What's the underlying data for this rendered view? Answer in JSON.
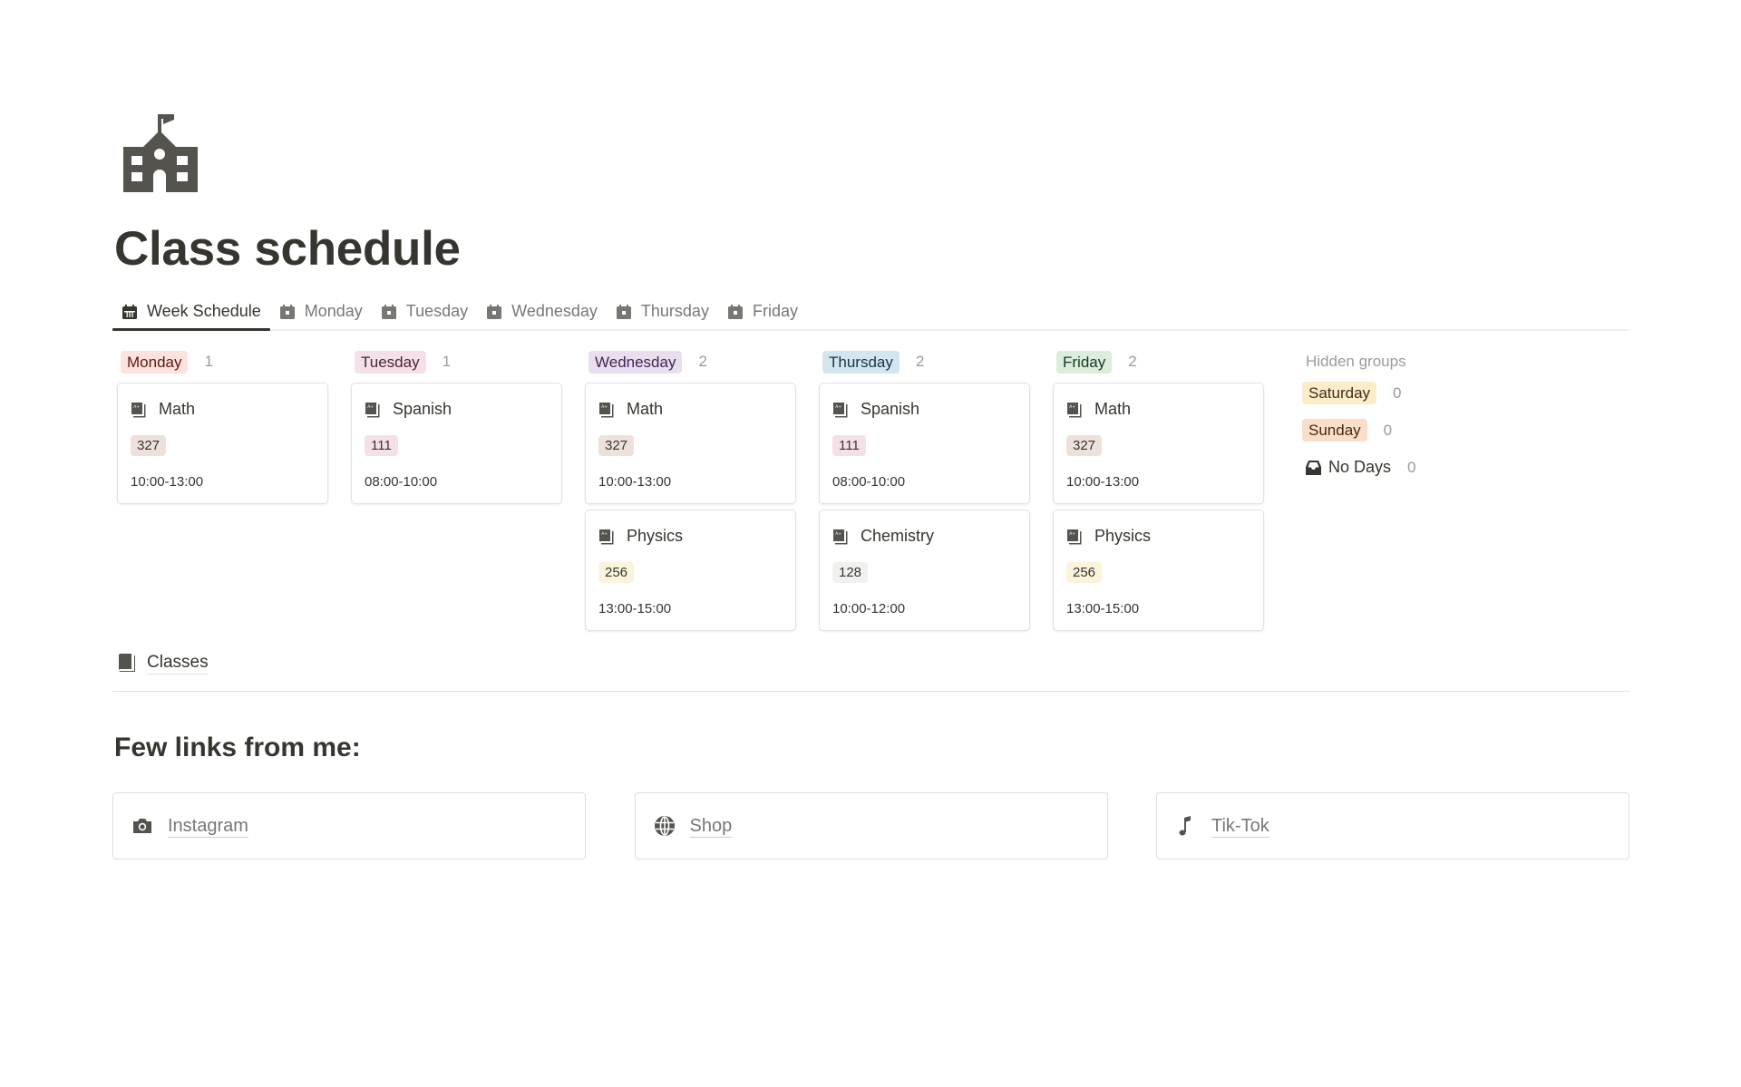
{
  "page": {
    "icon": "school-icon",
    "title": "Class schedule"
  },
  "tabs": [
    {
      "label": "Week Schedule",
      "icon": "calendar-grid-icon",
      "active": true
    },
    {
      "label": "Monday",
      "icon": "calendar-icon",
      "active": false
    },
    {
      "label": "Tuesday",
      "icon": "calendar-icon",
      "active": false
    },
    {
      "label": "Wednesday",
      "icon": "calendar-icon",
      "active": false
    },
    {
      "label": "Thursday",
      "icon": "calendar-icon",
      "active": false
    },
    {
      "label": "Friday",
      "icon": "calendar-icon",
      "active": false
    }
  ],
  "board": {
    "groups": [
      {
        "label": "Monday",
        "count": "1",
        "bg": "#fde2dd",
        "fg": "#5d1715",
        "cards": [
          {
            "title": "Math",
            "room": "327",
            "room_bg": "#eee0da",
            "time": "10:00-13:00"
          }
        ]
      },
      {
        "label": "Tuesday",
        "count": "1",
        "bg": "#f5e0e9",
        "fg": "#4c2337",
        "cards": [
          {
            "title": "Spanish",
            "room": "111",
            "room_bg": "#f5e0e9",
            "time": "08:00-10:00"
          }
        ]
      },
      {
        "label": "Wednesday",
        "count": "2",
        "bg": "#e8deee",
        "fg": "#412454",
        "cards": [
          {
            "title": "Math",
            "room": "327",
            "room_bg": "#eee0da",
            "time": "10:00-13:00"
          },
          {
            "title": "Physics",
            "room": "256",
            "room_bg": "#fbf3db",
            "time": "13:00-15:00"
          }
        ]
      },
      {
        "label": "Thursday",
        "count": "2",
        "bg": "#d3e5ef",
        "fg": "#183347",
        "cards": [
          {
            "title": "Spanish",
            "room": "111",
            "room_bg": "#f5e0e9",
            "time": "08:00-10:00"
          },
          {
            "title": "Chemistry",
            "room": "128",
            "room_bg": "#f1f1ef",
            "time": "10:00-12:00"
          }
        ]
      },
      {
        "label": "Friday",
        "count": "2",
        "bg": "#dbeddb",
        "fg": "#1c3829",
        "cards": [
          {
            "title": "Math",
            "room": "327",
            "room_bg": "#eee0da",
            "time": "10:00-13:00"
          },
          {
            "title": "Physics",
            "room": "256",
            "room_bg": "#fbf3db",
            "time": "13:00-15:00"
          }
        ]
      }
    ],
    "hidden": {
      "title": "Hidden groups",
      "items": [
        {
          "label": "Saturday",
          "count": "0",
          "bg": "#fdecc8",
          "fg": "#402c1b"
        },
        {
          "label": "Sunday",
          "count": "0",
          "bg": "#fadec9",
          "fg": "#49290e"
        }
      ],
      "no_days": {
        "label": "No Days",
        "count": "0",
        "icon": "inbox-icon"
      }
    }
  },
  "classes_link": {
    "label": "Classes",
    "icon": "book-icon"
  },
  "links_section": {
    "heading": "Few links from me:",
    "links": [
      {
        "label": "Instagram",
        "icon": "camera-icon"
      },
      {
        "label": "Shop",
        "icon": "globe-icon"
      },
      {
        "label": "Tik-Tok",
        "icon": "music-note-icon"
      }
    ]
  }
}
